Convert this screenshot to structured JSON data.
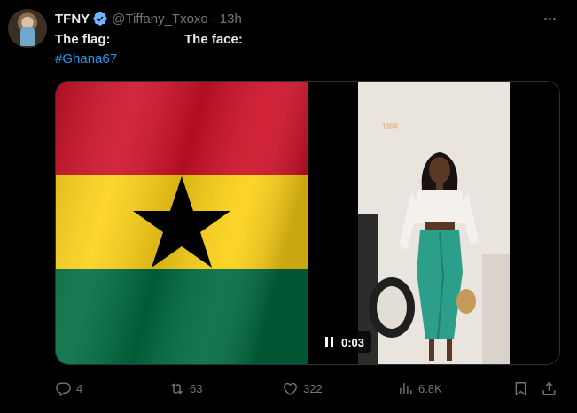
{
  "author": {
    "name": "TFNY",
    "handle": "@Tiffany_Txoxo",
    "separator": "·",
    "time": "13h"
  },
  "tweet": {
    "flag_label": "The flag:",
    "face_label": "The face:",
    "hashtag": "#Ghana67"
  },
  "media": {
    "watermark": "TIFF",
    "video_duration": "0:03",
    "flag_colors": {
      "red": "#ce1126",
      "gold": "#fcd116",
      "green": "#006b3f",
      "star": "#000000"
    }
  },
  "actions": {
    "replies": "4",
    "reposts": "63",
    "likes": "322",
    "views": "6.8K"
  },
  "icons": {
    "verified": "verified-badge-icon",
    "more": "more-icon",
    "reply": "reply-icon",
    "repost": "repost-icon",
    "like": "heart-icon",
    "views": "views-icon",
    "bookmark": "bookmark-icon",
    "share": "share-icon",
    "pause": "pause-icon"
  },
  "colors": {
    "background": "#000000",
    "text": "#e7e9ea",
    "muted": "#71767b",
    "link": "#1d9bf0",
    "verified": "#6fb4ff"
  }
}
